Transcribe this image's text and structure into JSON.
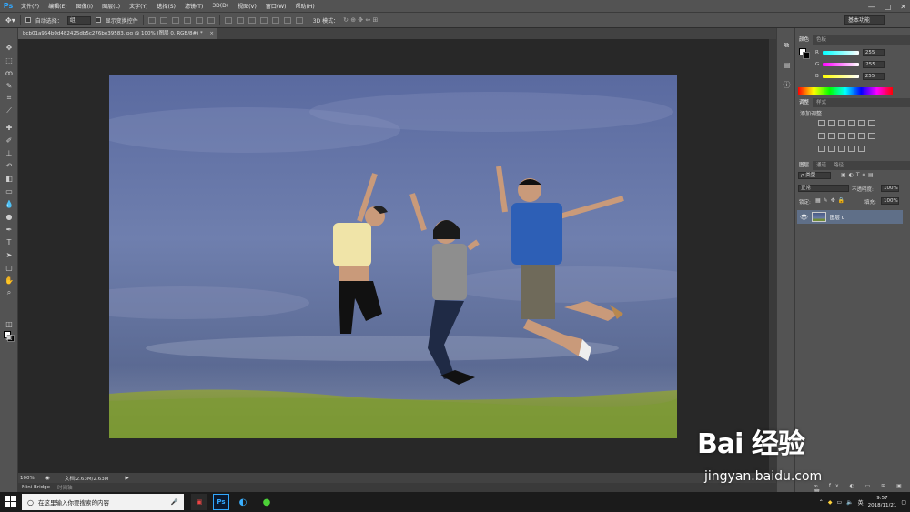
{
  "app": {
    "logo": "Ps"
  },
  "menu": [
    "文件(F)",
    "编辑(E)",
    "图像(I)",
    "图层(L)",
    "文字(Y)",
    "选择(S)",
    "滤镜(T)",
    "3D(D)",
    "视图(V)",
    "窗口(W)",
    "帮助(H)"
  ],
  "window_controls": {
    "minimize": "—",
    "maximize": "□",
    "close": "✕"
  },
  "options": {
    "auto_select_label": "自动选择：",
    "auto_select_value": "组",
    "show_transform_label": "显示变换控件",
    "mode_3d_label": "3D 模式：",
    "workspace": "基本功能"
  },
  "document": {
    "tab_title": "bcb01a954b0d482425db5c276be39583.jpg @ 100% (图层 0, RGB/8#) *",
    "close": "×"
  },
  "status": {
    "zoom": "100%",
    "doc_info": "文档:2.63M/2.63M"
  },
  "bottom_tabs": [
    "Mini Bridge",
    "时间轴"
  ],
  "color_panel": {
    "tabs": [
      "颜色",
      "色板"
    ],
    "channels": [
      {
        "label": "R",
        "value": "255",
        "color": "#ff4a4a"
      },
      {
        "label": "G",
        "value": "255",
        "color": "#4aff4a"
      },
      {
        "label": "B",
        "value": "255",
        "color": "#4a8bff"
      }
    ]
  },
  "adjustments_panel": {
    "tabs": [
      "调整",
      "样式"
    ],
    "add_label": "添加调整"
  },
  "layers_panel": {
    "tabs": [
      "图层",
      "通道",
      "路径"
    ],
    "filter_kind": "ρ 类型",
    "blend_mode": "正常",
    "opacity_label": "不透明度:",
    "opacity_value": "100%",
    "lock_label": "锁定:",
    "fill_label": "填充:",
    "fill_value": "100%",
    "layers": [
      {
        "name": "图层 0",
        "visible": true
      }
    ]
  },
  "taskbar": {
    "search_placeholder": "在这里输入你要搜索的内容",
    "apps": [
      "photo-app",
      "Ps",
      "browser",
      "wechat"
    ],
    "ime": "英",
    "time": "9:57",
    "date": "2018/11/21"
  },
  "watermark": {
    "main": "Bai 经验",
    "sub": "jingyan.baidu.com"
  }
}
